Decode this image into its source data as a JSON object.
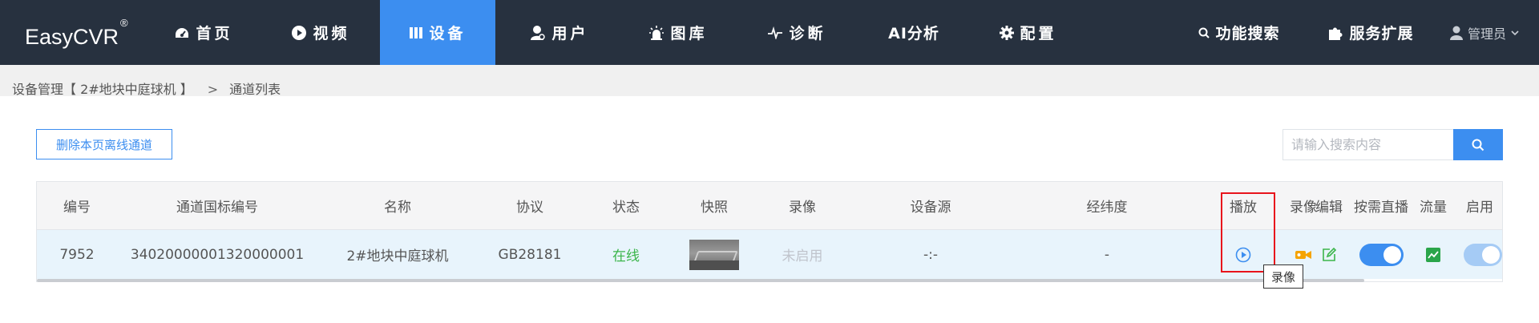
{
  "brand": {
    "name": "EasyCVR",
    "mark": "®"
  },
  "nav": {
    "items": [
      {
        "label": "首页",
        "icon": "dashboard-icon"
      },
      {
        "label": "视频",
        "icon": "play-circle-icon"
      },
      {
        "label": "设备",
        "icon": "device-icon",
        "active": true
      },
      {
        "label": "用户",
        "icon": "user-icon"
      },
      {
        "label": "图库",
        "icon": "alarm-icon"
      },
      {
        "label": "诊断",
        "icon": "pulse-icon"
      },
      {
        "label": "AI分析",
        "icon": ""
      },
      {
        "label": "配置",
        "icon": "gear-icon"
      }
    ],
    "feature_search": "功能搜索",
    "service_ext": "服务扩展",
    "user": "管理员"
  },
  "breadcrumb": {
    "device": "设备管理【 2#地块中庭球机 】",
    "separator": ">",
    "current": "通道列表"
  },
  "toolbar": {
    "delete_offline": "删除本页离线通道",
    "search_placeholder": "请输入搜索内容"
  },
  "table": {
    "headers": [
      "编号",
      "通道国标编号",
      "名称",
      "协议",
      "状态",
      "快照",
      "录像",
      "设备源",
      "经纬度",
      "播放",
      "录像",
      "编辑",
      "按需直播",
      "流量",
      "启用"
    ],
    "rows": [
      {
        "id": "7952",
        "gb_id": "34020000001320000001",
        "name": "2#地块中庭球机",
        "protocol": "GB28181",
        "status": "在线",
        "recording": "未启用",
        "source": "-:-",
        "latlng": "-",
        "on_demand_live": true,
        "enabled": true
      }
    ]
  },
  "tooltip": "录像",
  "colors": {
    "nav_bg": "#27313f",
    "accent": "#3c8ef0",
    "online": "#3bb54a",
    "record_icon": "#f5a300",
    "highlight": "#e8141c"
  }
}
